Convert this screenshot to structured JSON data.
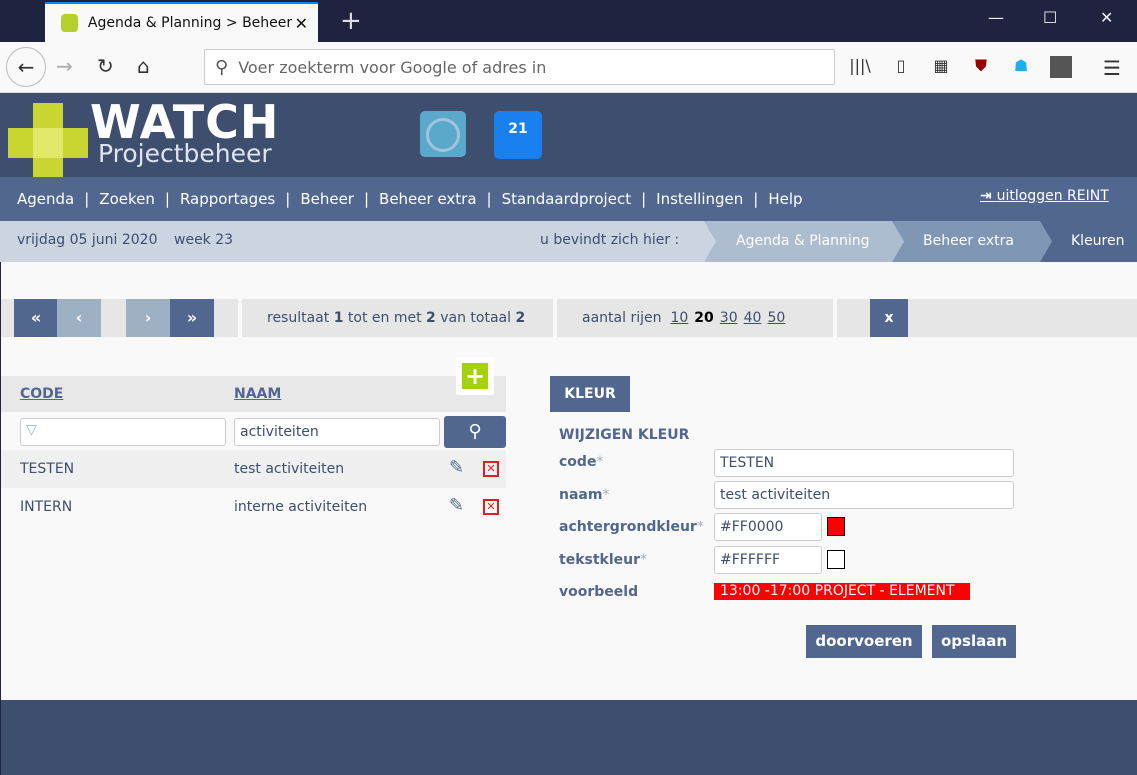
{
  "browser": {
    "tab_title": "Agenda & Planning > Beheer extra",
    "url_placeholder": "Voer zoekterm voor Google of adres in"
  },
  "header": {
    "logo_title": "WATCH",
    "logo_subtitle": "Projectbeheer",
    "calendar_day": "21"
  },
  "nav": {
    "items": [
      "Agenda",
      "Zoeken",
      "Rapportages",
      "Beheer",
      "Beheer extra",
      "Standaardproject",
      "Instellingen",
      "Help"
    ],
    "logout": "uitloggen REINT"
  },
  "crumbs": {
    "date": "vrijdag 05 juni 2020",
    "week": "week 23",
    "here": "u bevindt zich hier :",
    "items": [
      "Agenda & Planning",
      "Beheer extra",
      "Kleuren"
    ]
  },
  "pager": {
    "first": "«",
    "prev": "‹",
    "next": "›",
    "last": "»",
    "result_a": "resultaat ",
    "from": "1",
    "result_b": " tot en met ",
    "to": "2",
    "result_c": " van totaal ",
    "total": "2",
    "rows_label": "aantal rijen",
    "row_options": [
      "10",
      "20",
      "30",
      "40",
      "50"
    ],
    "current_rows": "20"
  },
  "table": {
    "headers": [
      "CODE",
      "NAAM"
    ],
    "filter_code": "",
    "filter_naam": "activiteiten",
    "rows": [
      {
        "code": "TESTEN",
        "naam": "test activiteiten"
      },
      {
        "code": "INTERN",
        "naam": "interne activiteiten"
      }
    ]
  },
  "form": {
    "tab": "KLEUR",
    "title": "WIJZIGEN KLEUR",
    "labels": {
      "code": "code",
      "naam": "naam",
      "bg": "achtergrondkleur",
      "fg": "tekstkleur",
      "preview": "voorbeeld"
    },
    "required": "*",
    "code": "TESTEN",
    "naam": "test activiteiten",
    "bg": "#FF0000",
    "fg": "#FFFFFF",
    "preview_text": "13:00 -17:00 PROJECT - ELEMENT",
    "apply": "doorvoeren",
    "save": "opslaan"
  },
  "colors": {
    "accent": "#52678f",
    "header": "#3d4e6e",
    "add": "#a6d20b",
    "delete": "#e02020"
  }
}
